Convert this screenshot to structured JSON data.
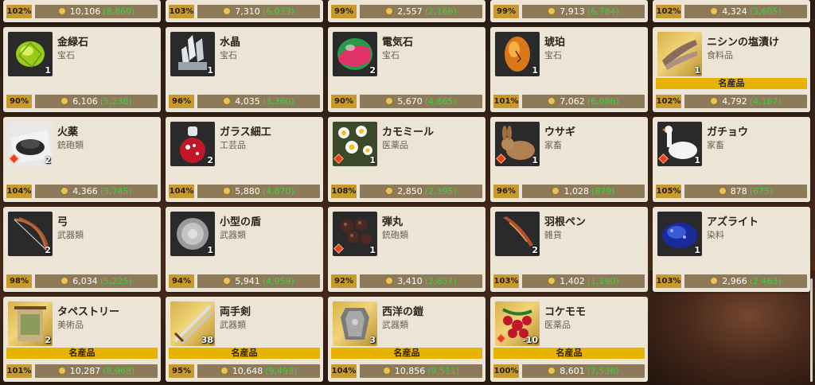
{
  "top_row": [
    {
      "pct": "102%",
      "price": "10,106",
      "base": "(8,869)"
    },
    {
      "pct": "103%",
      "price": "7,310",
      "base": "(6,033)"
    },
    {
      "pct": "99%",
      "price": "2,557",
      "base": "(2,166)"
    },
    {
      "pct": "99%",
      "price": "7,913",
      "base": "(6,784)"
    },
    {
      "pct": "102%",
      "price": "4,324",
      "base": "(3,605)"
    }
  ],
  "items": [
    {
      "name": "金緑石",
      "category": "宝石",
      "qty": "1",
      "specialty": "",
      "pct": "90%",
      "price": "6,106",
      "base": "(5,238)",
      "icon": "chrysoberyl-icon"
    },
    {
      "name": "水晶",
      "category": "宝石",
      "qty": "1",
      "specialty": "",
      "pct": "96%",
      "price": "4,035",
      "base": "(3,360)",
      "icon": "crystal-icon"
    },
    {
      "name": "電気石",
      "category": "宝石",
      "qty": "2",
      "specialty": "",
      "pct": "90%",
      "price": "5,670",
      "base": "(4,865)",
      "icon": "tourmaline-icon"
    },
    {
      "name": "琥珀",
      "category": "宝石",
      "qty": "1",
      "specialty": "",
      "pct": "101%",
      "price": "7,062",
      "base": "(6,086)",
      "icon": "amber-icon"
    },
    {
      "name": "ニシンの塩漬け",
      "category": "食料品",
      "qty": "1",
      "specialty": "名産品",
      "pct": "102%",
      "price": "4,792",
      "base": "(4,187)",
      "icon": "salted-herring-icon"
    },
    {
      "name": "火薬",
      "category": "銃砲類",
      "qty": "2",
      "specialty": "",
      "pct": "104%",
      "price": "4,366",
      "base": "(3,745)",
      "icon": "gunpowder-icon"
    },
    {
      "name": "ガラス細工",
      "category": "工芸品",
      "qty": "2",
      "specialty": "",
      "pct": "104%",
      "price": "5,880",
      "base": "(4,870)",
      "icon": "glasswork-icon"
    },
    {
      "name": "カモミール",
      "category": "医薬品",
      "qty": "1",
      "specialty": "",
      "pct": "108%",
      "price": "2,850",
      "base": "(2,395)",
      "icon": "chamomile-icon"
    },
    {
      "name": "ウサギ",
      "category": "家畜",
      "qty": "1",
      "specialty": "",
      "pct": "96%",
      "price": "1,028",
      "base": "(879)",
      "icon": "rabbit-icon"
    },
    {
      "name": "ガチョウ",
      "category": "家畜",
      "qty": "1",
      "specialty": "",
      "pct": "105%",
      "price": "878",
      "base": "(675)",
      "icon": "goose-icon"
    },
    {
      "name": "弓",
      "category": "武器類",
      "qty": "2",
      "specialty": "",
      "pct": "98%",
      "price": "6,034",
      "base": "(5,225)",
      "icon": "bow-icon"
    },
    {
      "name": "小型の盾",
      "category": "武器類",
      "qty": "1",
      "specialty": "",
      "pct": "94%",
      "price": "5,941",
      "base": "(4,959)",
      "icon": "small-shield-icon"
    },
    {
      "name": "弾丸",
      "category": "銃砲類",
      "qty": "1",
      "specialty": "",
      "pct": "92%",
      "price": "3,410",
      "base": "(2,857)",
      "icon": "bullets-icon"
    },
    {
      "name": "羽根ペン",
      "category": "雑貨",
      "qty": "2",
      "specialty": "",
      "pct": "103%",
      "price": "1,402",
      "base": "(1,190)",
      "icon": "quill-pen-icon"
    },
    {
      "name": "アズライト",
      "category": "染料",
      "qty": "1",
      "specialty": "",
      "pct": "103%",
      "price": "2,966",
      "base": "(2,463)",
      "icon": "azurite-icon"
    },
    {
      "name": "タペストリー",
      "category": "美術品",
      "qty": "2",
      "specialty": "名産品",
      "pct": "101%",
      "price": "10,287",
      "base": "(8,968)",
      "icon": "tapestry-icon"
    },
    {
      "name": "両手剣",
      "category": "武器類",
      "qty": "38",
      "specialty": "名産品",
      "pct": "95%",
      "price": "10,648",
      "base": "(9,493)",
      "icon": "two-handed-sword-icon"
    },
    {
      "name": "西洋の鎧",
      "category": "武器類",
      "qty": "3",
      "specialty": "名産品",
      "pct": "104%",
      "price": "10,856",
      "base": "(9,511)",
      "icon": "western-armor-icon"
    },
    {
      "name": "コケモモ",
      "category": "医薬品",
      "qty": "-10",
      "specialty": "名産品",
      "pct": "100%",
      "price": "8,601",
      "base": "(7,536)",
      "icon": "lingonberry-icon"
    }
  ]
}
